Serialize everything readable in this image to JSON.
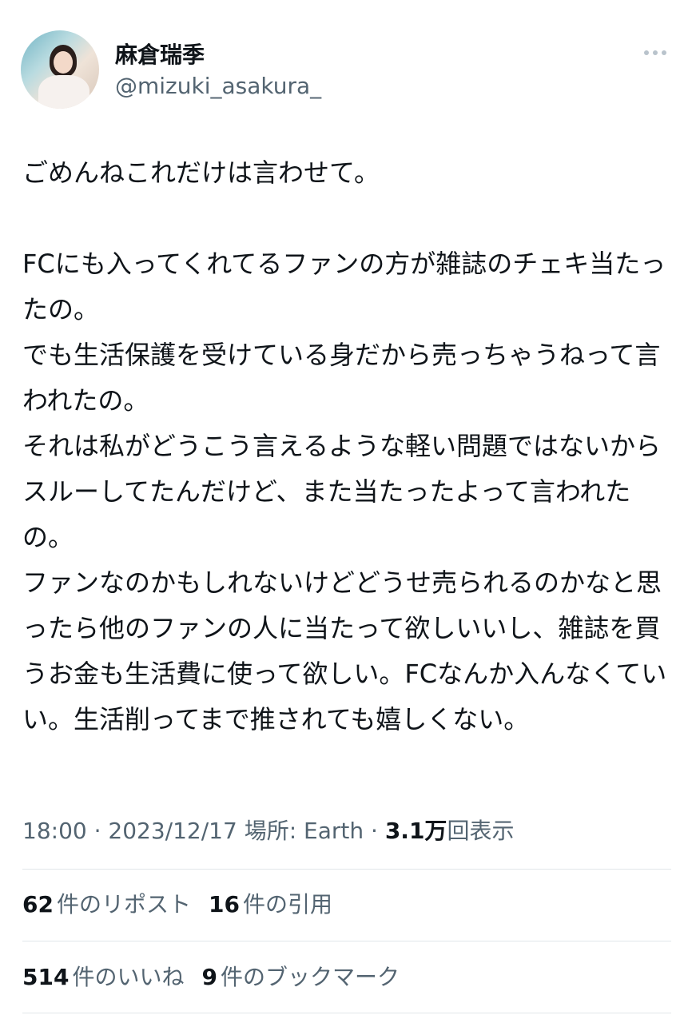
{
  "user": {
    "display_name": "麻倉瑞季",
    "handle": "@mizuki_asakura_"
  },
  "tweet": {
    "text": "ごめんねこれだけは言わせて。\n\nFCにも入ってくれてるファンの方が雑誌のチェキ当たったの。\nでも生活保護を受けている身だから売っちゃうねって言われたの。\nそれは私がどうこう言えるような軽い問題ではないからスルーしてたんだけど、また当たったよって言われたの。\nファンなのかもしれないけどどうせ売られるのかなと思ったら他のファンの人に当たって欲しいいし、雑誌を買うお金も生活費に使って欲しい。FCなんか入んなくていい。生活削ってまで推されても嬉しくない。"
  },
  "meta": {
    "time": "18:00",
    "sep1": " · ",
    "date": "2023/12/17",
    "location": " 場所: Earth",
    "sep2": " · ",
    "views_count": "3.1万",
    "views_label": "回表示"
  },
  "stats": {
    "reposts": {
      "count": "62",
      "label": "件のリポスト"
    },
    "quotes": {
      "count": "16",
      "label": "件の引用"
    },
    "likes": {
      "count": "514",
      "label": "件のいいね"
    },
    "bookmarks": {
      "count": "9",
      "label": "件のブックマーク"
    }
  },
  "icons": {
    "more": "more-horizontal-icon"
  }
}
